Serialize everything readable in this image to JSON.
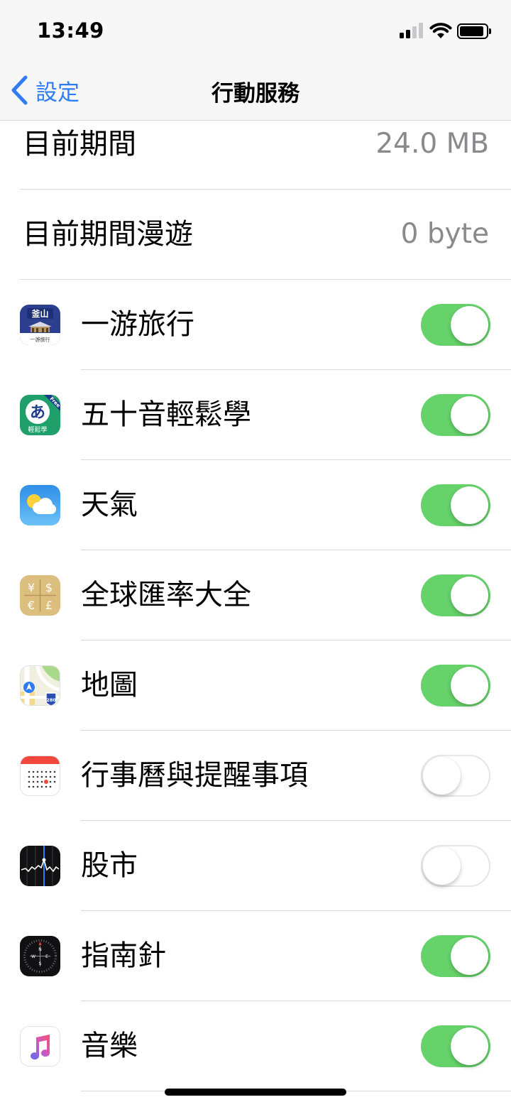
{
  "status_bar": {
    "time": "13:49",
    "icons": [
      "cellular-signal-icon",
      "wifi-icon",
      "battery-icon"
    ]
  },
  "nav": {
    "back_label": "設定",
    "title": "行動服務"
  },
  "usage": [
    {
      "label": "目前期間",
      "value": "24.0 MB"
    },
    {
      "label": "目前期間漫遊",
      "value": "0 byte"
    }
  ],
  "apps": [
    {
      "name": "一游旅行",
      "icon": "busan-travel-app-icon",
      "icon_text": "釜山",
      "icon_caption": "一游旅行",
      "enabled": true
    },
    {
      "name": "五十音輕鬆學",
      "icon": "japanese-kana-app-icon",
      "icon_text": "あ",
      "icon_caption": "輕鬆學",
      "icon_ribbon": "Free",
      "enabled": true
    },
    {
      "name": "天氣",
      "icon": "weather-app-icon",
      "enabled": true
    },
    {
      "name": "全球匯率大全",
      "icon": "currency-exchange-app-icon",
      "icon_symbols": [
        "¥",
        "$",
        "€",
        "£"
      ],
      "enabled": true
    },
    {
      "name": "地圖",
      "icon": "maps-app-icon",
      "icon_shield": "280",
      "enabled": true
    },
    {
      "name": "行事曆與提醒事項",
      "icon": "calendar-app-icon",
      "enabled": false
    },
    {
      "name": "股市",
      "icon": "stocks-app-icon",
      "enabled": false
    },
    {
      "name": "指南針",
      "icon": "compass-app-icon",
      "icon_letters": [
        "W",
        "N",
        "E",
        "S"
      ],
      "enabled": true
    },
    {
      "name": "音樂",
      "icon": "music-app-icon",
      "enabled": true
    }
  ],
  "colors": {
    "accent": "#2f7cf6",
    "toggle_on": "#65d26a",
    "toggle_off_border": "#e5e5ea",
    "secondary_text": "#8a8a8e"
  }
}
